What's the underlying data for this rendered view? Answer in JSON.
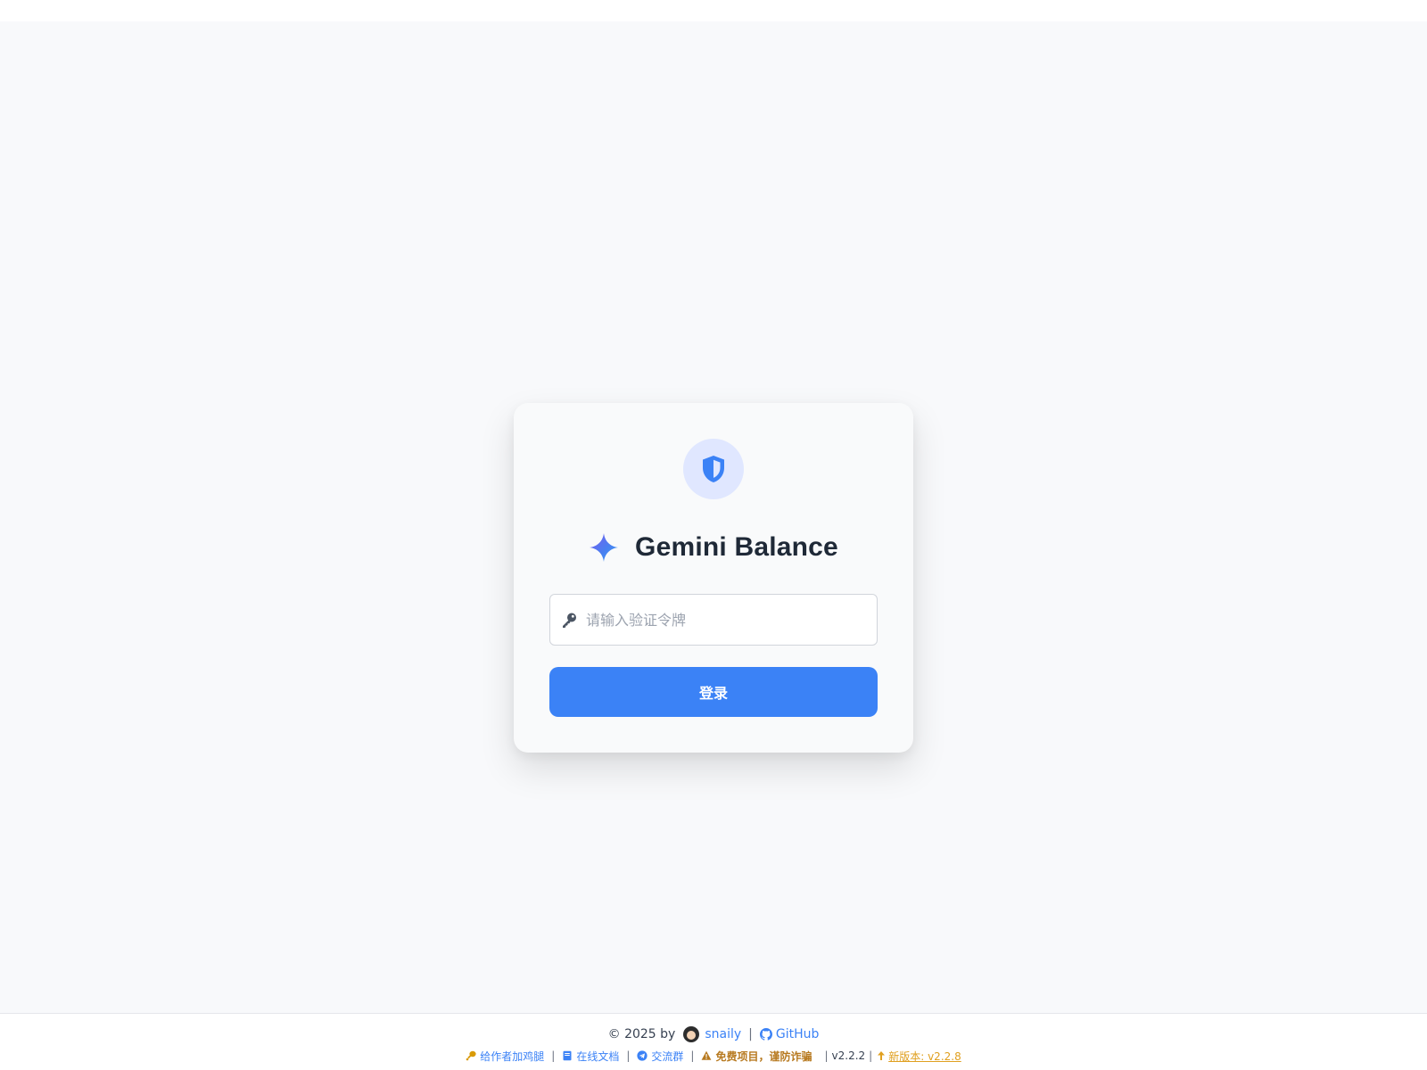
{
  "login": {
    "title": "Gemini Balance",
    "token_placeholder": "请输入验证令牌",
    "token_value": "",
    "submit_label": "登录"
  },
  "footer": {
    "copyright": "© 2025 by",
    "author": "snaily",
    "github_label": "GitHub",
    "sponsor_label": "给作者加鸡腿",
    "docs_label": "在线文档",
    "group_label": "交流群",
    "warning_label": "免费项目，谨防诈骗",
    "version": "v2.2.2",
    "new_version_label": "新版本: v2.2.8",
    "separator": "|"
  },
  "colors": {
    "primary": "#3b82f6",
    "shield_bg": "#e0e7ff",
    "warning": "#b7791f",
    "sponsor": "#d99a06",
    "page_bg": "#f8f9fb"
  },
  "icons": [
    "shield-icon",
    "sparkle-icon",
    "key-icon",
    "avatar",
    "github-icon",
    "drumstick-icon",
    "book-icon",
    "telegram-icon",
    "warning-icon",
    "arrow-up-icon"
  ]
}
